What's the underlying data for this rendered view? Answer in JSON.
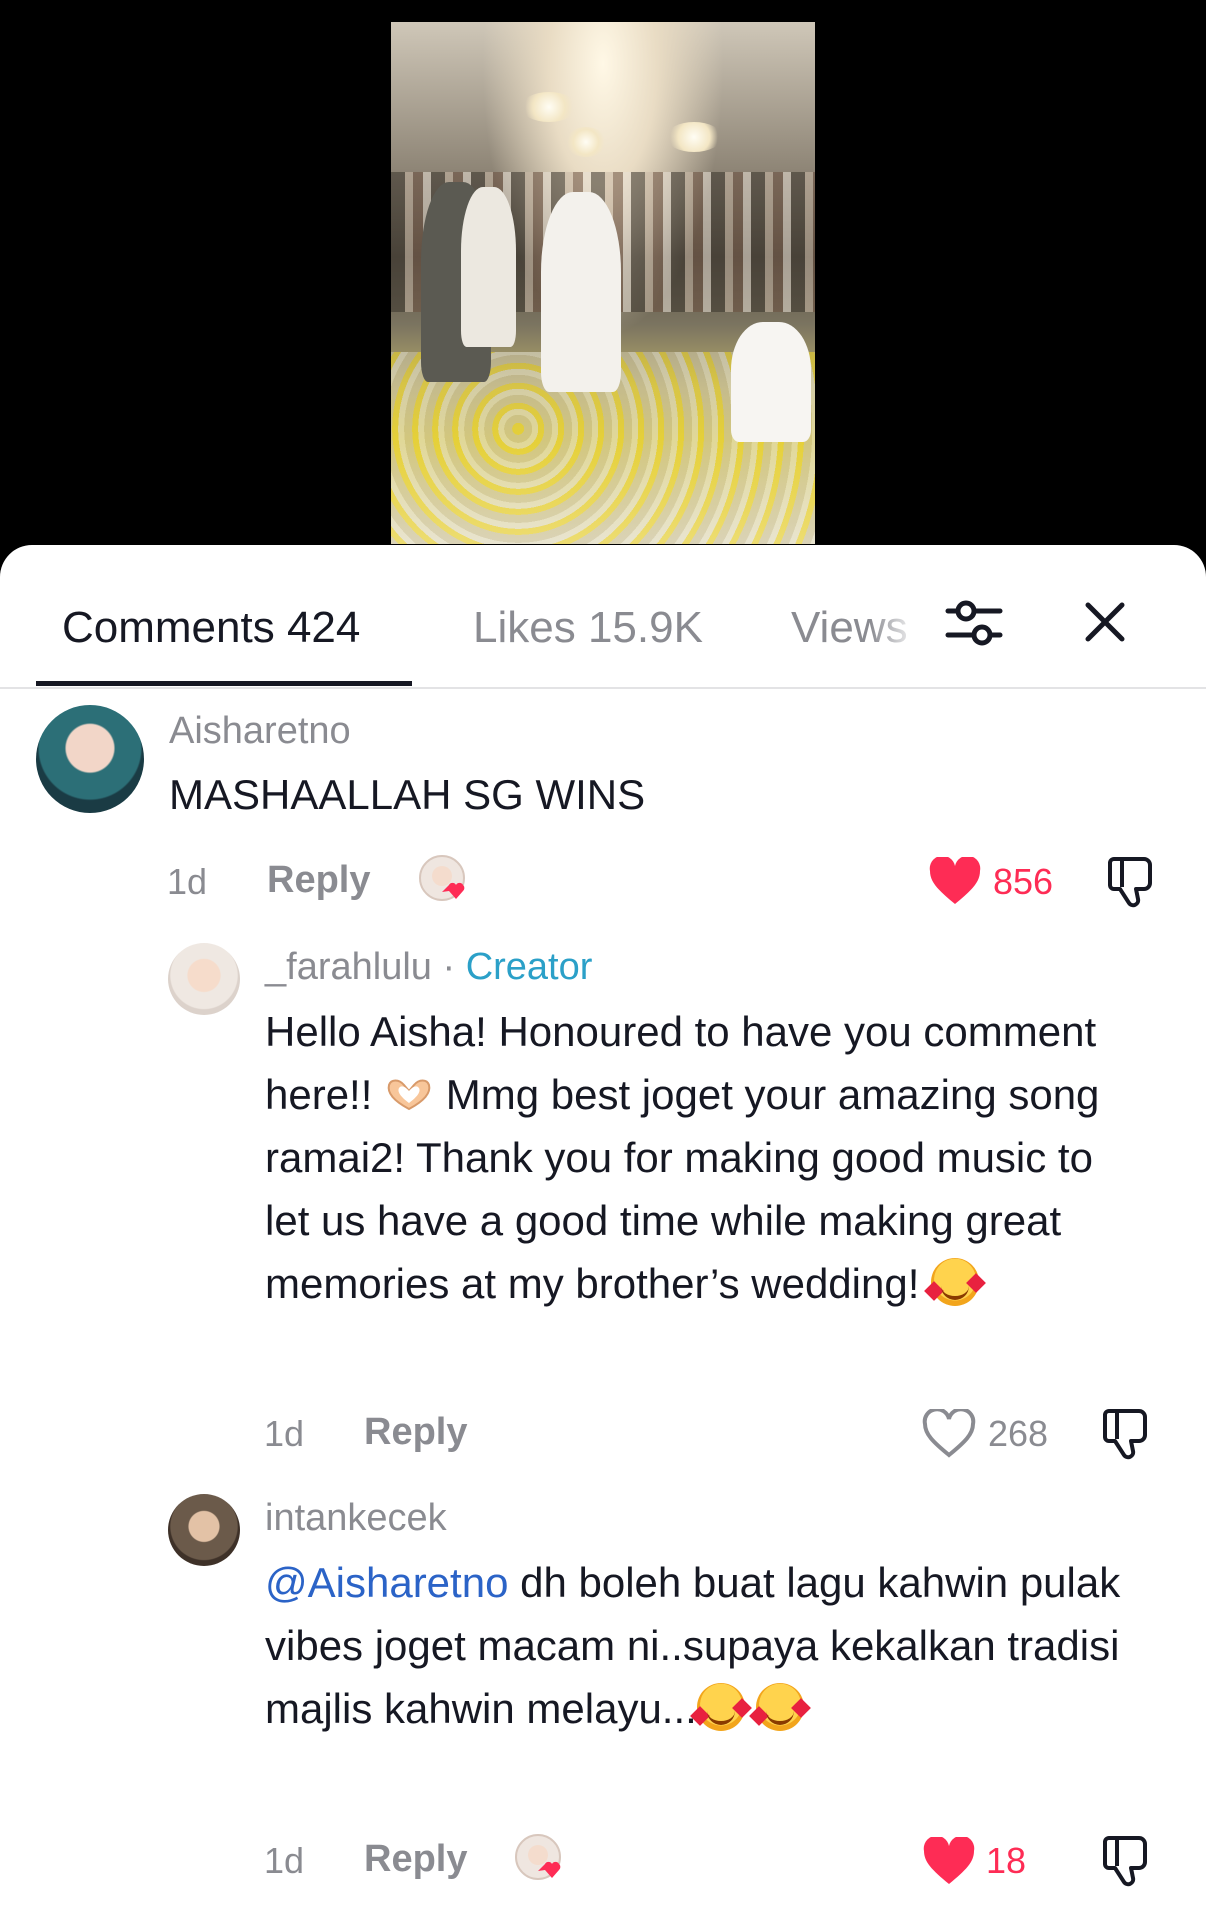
{
  "colors": {
    "like_red": "#fe2c55",
    "creator_blue": "#2ba0c8",
    "mention_blue": "#2b63c7",
    "muted": "#8a8b91",
    "text": "#161823"
  },
  "tabs": [
    {
      "label": "Comments 424",
      "active": true
    },
    {
      "label": "Likes 15.9K",
      "active": false
    },
    {
      "label": "Views",
      "active": false
    }
  ],
  "header_icons": [
    "filter-sliders-icon",
    "close-icon"
  ],
  "comments": [
    {
      "username": "Aisharetno",
      "text": "MASHAALLAH SG WINS",
      "time": "1d",
      "reply_label": "Reply",
      "likes": "856",
      "liked": true,
      "creator_liked": true
    },
    {
      "username": "_farahlulu",
      "separator": " · ",
      "badge": "Creator",
      "text_parts": [
        "Hello Aisha! Honoured to have you comment here!!",
        "Mmg best joget your amazing song ramai2! Thank you for making good music to let us have a good time while making great memories at my brother’s wedding!"
      ],
      "emojis": [
        "heart-hands",
        "smiling-face-with-hearts"
      ],
      "time": "1d",
      "reply_label": "Reply",
      "likes": "268",
      "liked": false
    },
    {
      "username": "intankecek",
      "mention": "@Aisharetno",
      "text": "dh boleh buat lagu kahwin pulak vibes joget macam ni..supaya kekalkan tradisi majlis kahwin melayu...",
      "emojis": [
        "smiling-face-with-hearts",
        "smiling-face-with-hearts"
      ],
      "time": "1d",
      "reply_label": "Reply",
      "likes": "18",
      "liked": true,
      "creator_liked": true
    }
  ]
}
